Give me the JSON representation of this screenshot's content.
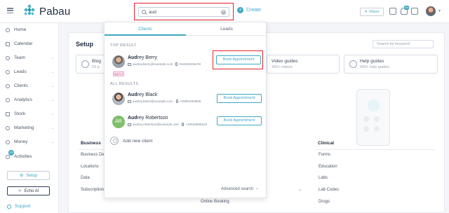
{
  "app": {
    "name": "Pabau"
  },
  "topbar": {
    "search_value": "aud",
    "create_label": "Create",
    "vision_label": "Vision",
    "notifications_badge": "99"
  },
  "sidebar": {
    "items": [
      {
        "label": "Home",
        "expandable": false
      },
      {
        "label": "Calendar",
        "expandable": false
      },
      {
        "label": "Team",
        "expandable": true
      },
      {
        "label": "Leads",
        "expandable": true
      },
      {
        "label": "Clients",
        "expandable": true
      },
      {
        "label": "Analytics",
        "expandable": true
      },
      {
        "label": "Stock",
        "expandable": true
      },
      {
        "label": "Marketing",
        "expandable": true
      },
      {
        "label": "Money",
        "expandable": true
      },
      {
        "label": "Activities",
        "expandable": false
      }
    ],
    "activities_badge": "10",
    "setup_button": "Setup",
    "echo_button": "Echo AI",
    "support_label": "Support"
  },
  "main": {
    "title": "Setup",
    "keyword_placeholder": "Search by keyword",
    "tiles": [
      {
        "title": "Blog",
        "subtitle": "53 p"
      },
      {
        "title": "Video guides",
        "subtitle": "300+ videos"
      },
      {
        "title": "Help guides",
        "subtitle": "500+ help guides"
      }
    ],
    "business_col": {
      "header": "Business",
      "items": [
        "Business De",
        "Locations",
        "Data",
        "Subscription"
      ]
    },
    "middle_col": {
      "items": [
        "Online Booking"
      ]
    },
    "clinical_col": {
      "header": "Clinical",
      "items": [
        "Forms",
        "Education",
        "Labs",
        "Lab Codes",
        "Drugs"
      ]
    }
  },
  "dropdown": {
    "tabs": [
      {
        "label": "Clients",
        "active": true
      },
      {
        "label": "Leads",
        "active": false
      }
    ],
    "top_result_label": "TOP RESULT",
    "all_results_label": "ALL RESULTS",
    "top_result": {
      "match": "Aud",
      "rest": "rey Berry",
      "email": "audrey.berry@example.com",
      "phone": "012946326478",
      "tag": "WAITLT",
      "button": "Book Appointment"
    },
    "all_results": [
      {
        "match": "Aud",
        "rest": "rey Black",
        "email": "audrey.black@example.com",
        "phone": "+15854463555",
        "avatar_type": "photo",
        "button": "Book Appointment"
      },
      {
        "match": "Aud",
        "rest": "rey Robertson",
        "email": "audrey.robertson@example.com",
        "phone": "+40533669310",
        "avatar_type": "initials",
        "initials": "AR",
        "button": "Book Appointment"
      }
    ],
    "add_new_label": "Add new client",
    "advanced_search_label": "Advanced search"
  },
  "colors": {
    "accent": "#3fa7c4",
    "highlight_box": "#e0242c",
    "initials_avatar": "#7fbf6a"
  }
}
